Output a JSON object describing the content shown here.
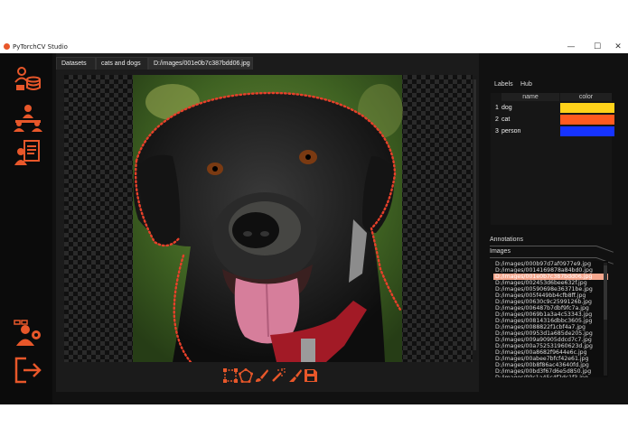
{
  "window": {
    "title": "PyTorchCV Studio",
    "minimize": "—",
    "maximize": "☐",
    "close": "✕"
  },
  "tabs": [
    {
      "label": "Datasets"
    },
    {
      "label": "cats and dogs"
    },
    {
      "label": "D:/images/001e0b7c387bdd06.jpg"
    }
  ],
  "leftbar": {
    "icons": [
      "database-user-icon",
      "team-icon",
      "report-icon",
      "user-settings-icon",
      "exit-icon"
    ]
  },
  "toolbar": {
    "tools": [
      "bounding-box-tool-icon",
      "polygon-tool-icon",
      "brush-tool-icon",
      "magic-wand-tool-icon",
      "eraser-tool-icon",
      "save-icon"
    ]
  },
  "right_panel": {
    "tabs": [
      {
        "label": "Labels"
      },
      {
        "label": "Hub"
      }
    ],
    "columns": {
      "name": "name",
      "color": "color"
    },
    "labels": [
      {
        "index": "1",
        "name": "dog",
        "color": "#ffd21a"
      },
      {
        "index": "2",
        "name": "cat",
        "color": "#ff5a1f"
      },
      {
        "index": "3",
        "name": "person",
        "color": "#1633ff"
      }
    ],
    "annotations_header": "Annotations",
    "images_header": "Images",
    "images": [
      "D:/images/000b97d7af0977e9.jpg",
      "D:/images/0014169878a84bd0.jpg",
      "D:/images/001e0b7c387bdd06.jpg",
      "D:/images/002453d6bee632f.jpg",
      "D:/images/00590698e36371be.jpg",
      "D:/images/005f449bb4cfb8ff.jpg",
      "D:/images/00630c9c2599126b.jpg",
      "D:/images/006487b7dbf9fc7a.jpg",
      "D:/images/0069b1a3a4c53343.jpg",
      "D:/images/00814316dbbc3605.jpg",
      "D:/images/0088822f1cbf4a7.jpg",
      "D:/images/00953d1a685de205.jpg",
      "D:/images/009a90905ddcd7c7.jpg",
      "D:/images/00a752531960623d.jpg",
      "D:/images/00a8682f9644e6c.jpg",
      "D:/images/00abee7bfcf42e61.jpg",
      "D:/images/00b8f86ac43640fd.jpg",
      "D:/images/00bd3f67d6e5d850.jpg",
      "D:/images/00c1a45c4f2dc1f3.jpg"
    ],
    "selected_image_index": 2
  },
  "colors": {
    "accent": "#e8572a",
    "background": "#111111",
    "selection": "#f6a78e"
  }
}
